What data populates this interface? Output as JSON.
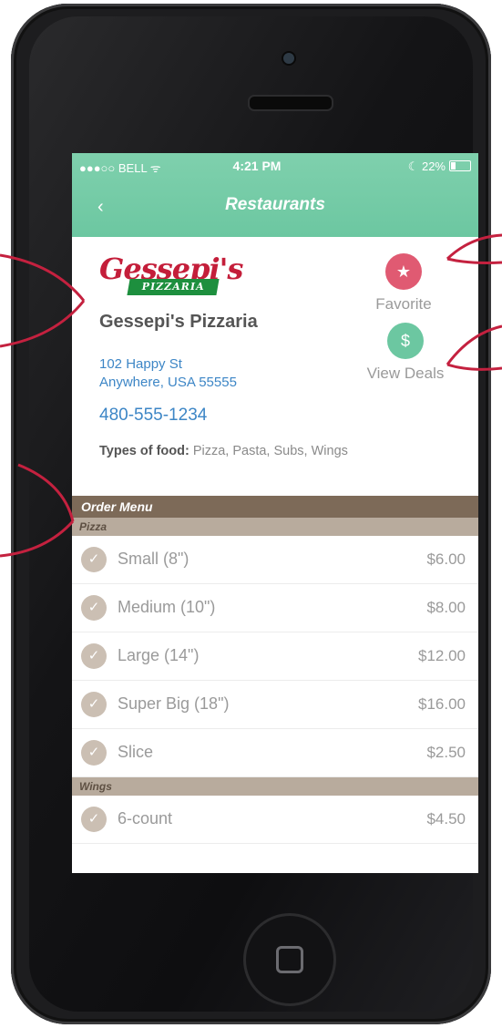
{
  "status_bar": {
    "carrier": "●●●○○ BELL ᯤ",
    "time": "4:21 PM",
    "battery": "☾ 22%"
  },
  "nav": {
    "back": "‹",
    "title": "Restaurants"
  },
  "restaurant": {
    "logo_script": "Gessepi's",
    "logo_band": "PIZZARIA",
    "name": "Gessepi's Pizzaria",
    "address_line1": "102 Happy St",
    "address_line2": "Anywhere, USA 55555",
    "phone": "480-555-1234",
    "types_label": "Types of food:",
    "types_value": " Pizza, Pasta, Subs, Wings"
  },
  "actions": {
    "favorite_icon": "★",
    "favorite_label": "Favorite",
    "deals_icon": "$",
    "deals_label": "View Deals"
  },
  "menu": {
    "header": "Order Menu",
    "sections": [
      {
        "name": "Pizza",
        "items": [
          {
            "name": "Small (8\")",
            "price": "$6.00"
          },
          {
            "name": "Medium (10\")",
            "price": "$8.00"
          },
          {
            "name": "Large (14\")",
            "price": "$12.00"
          },
          {
            "name": "Super Big (18\")",
            "price": "$16.00"
          },
          {
            "name": "Slice",
            "price": "$2.50"
          }
        ]
      },
      {
        "name": "Wings",
        "items": [
          {
            "name": "6-count",
            "price": "$4.50"
          }
        ]
      }
    ]
  },
  "colors": {
    "header_green": "#6cc7a1",
    "favorite_pink": "#e05a72",
    "menu_brown": "#7d6a58",
    "section_tan": "#b8ab9d",
    "link_blue": "#3d86c6",
    "arrow_red": "#c4213f"
  }
}
